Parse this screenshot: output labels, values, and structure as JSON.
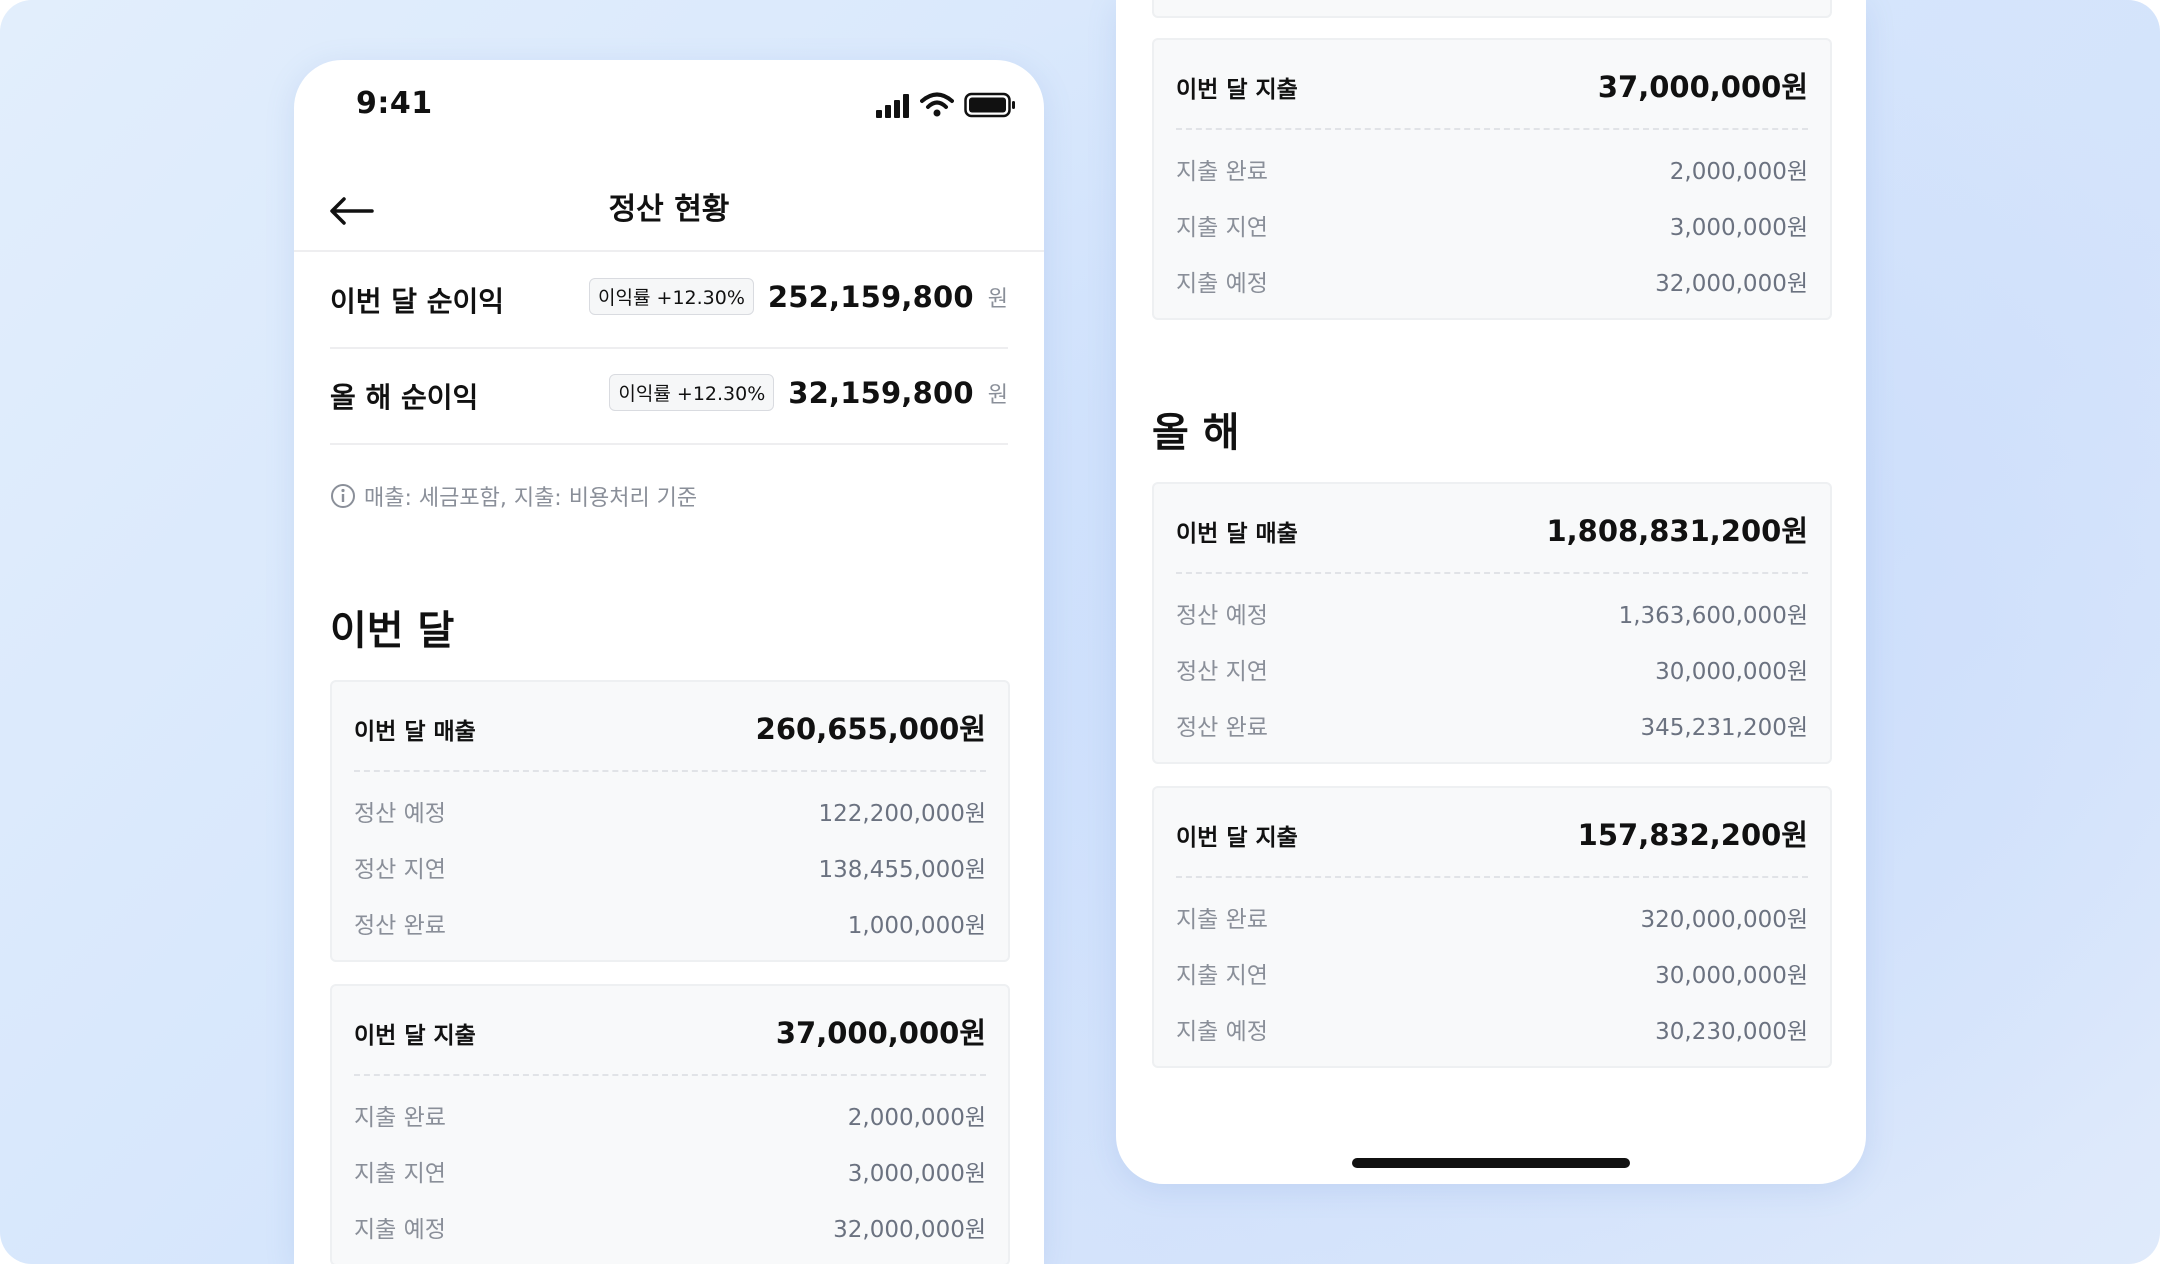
{
  "status_bar": {
    "time": "9:41",
    "icons": [
      "signal-icon",
      "wifi-icon",
      "battery-icon"
    ]
  },
  "header": {
    "title": "정산 현황",
    "back_icon": "arrow-left-icon"
  },
  "summary": {
    "monthly": {
      "label": "이번 달 순이익",
      "badge": "이익률 +12.30%",
      "value": "252,159,800",
      "unit": "원"
    },
    "yearly": {
      "label": "올 해 순이익",
      "badge": "이익률 +12.30%",
      "value": "32,159,800",
      "unit": "원"
    },
    "note": "매출: 세금포함, 지출: 비용처리 기준"
  },
  "this_month": {
    "title": "이번 달",
    "revenue": {
      "title": "이번 달 매출",
      "total": "260,655,000원",
      "rows": [
        {
          "label": "정산 예정",
          "value": "122,200,000원"
        },
        {
          "label": "정산 지연",
          "value": "138,455,000원"
        },
        {
          "label": "정산 완료",
          "value": "1,000,000원"
        }
      ]
    },
    "expense": {
      "title": "이번 달 지출",
      "total": "37,000,000원",
      "rows": [
        {
          "label": "지출 완료",
          "value": "2,000,000원"
        },
        {
          "label": "지출 지연",
          "value": "3,000,000원"
        },
        {
          "label": "지출 예정",
          "value": "32,000,000원"
        }
      ]
    }
  },
  "this_year": {
    "title": "올 해",
    "revenue": {
      "title": "이번 달 매출",
      "total": "1,808,831,200원",
      "rows": [
        {
          "label": "정산 예정",
          "value": "1,363,600,000원"
        },
        {
          "label": "정산 지연",
          "value": "30,000,000원"
        },
        {
          "label": "정산 완료",
          "value": "345,231,200원"
        }
      ]
    },
    "expense": {
      "title": "이번 달 지출",
      "total": "157,832,200원",
      "rows": [
        {
          "label": "지출 완료",
          "value": "320,000,000원"
        },
        {
          "label": "지출 지연",
          "value": "30,000,000원"
        },
        {
          "label": "지출 예정",
          "value": "30,230,000원"
        }
      ]
    }
  },
  "colors": {
    "background": "#d9e7fc",
    "card": "#f8f9fa",
    "muted_text": "#8a8f99",
    "text": "#111111"
  }
}
